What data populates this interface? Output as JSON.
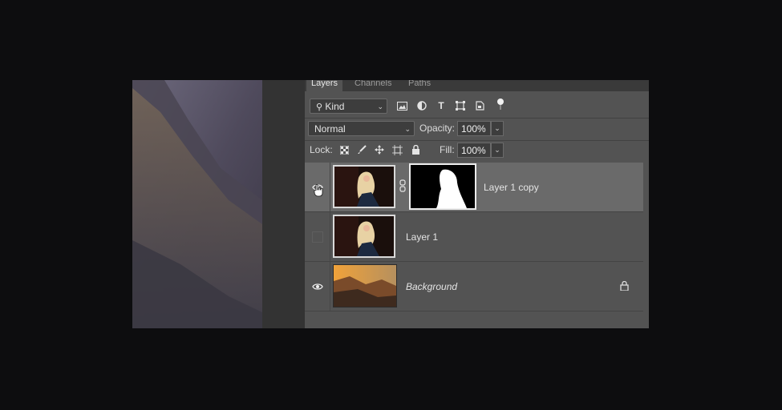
{
  "tabs": [
    "Layers",
    "Channels",
    "Paths"
  ],
  "filter": {
    "kind_label": "Kind"
  },
  "blend": {
    "mode": "Normal",
    "opacity_label": "Opacity:",
    "opacity_value": "100%"
  },
  "lock": {
    "label": "Lock:",
    "fill_label": "Fill:",
    "fill_value": "100%"
  },
  "layers": [
    {
      "name": "Layer 1 copy",
      "visible": true,
      "selected": true,
      "has_mask": true
    },
    {
      "name": "Layer 1",
      "visible": false,
      "selected": false,
      "has_mask": false
    },
    {
      "name": "Background",
      "visible": true,
      "selected": false,
      "locked": true
    }
  ],
  "colors": {
    "panel_bg": "#535353",
    "selected_row": "#6a6a6a",
    "app_bg": "#0d0d0f"
  }
}
